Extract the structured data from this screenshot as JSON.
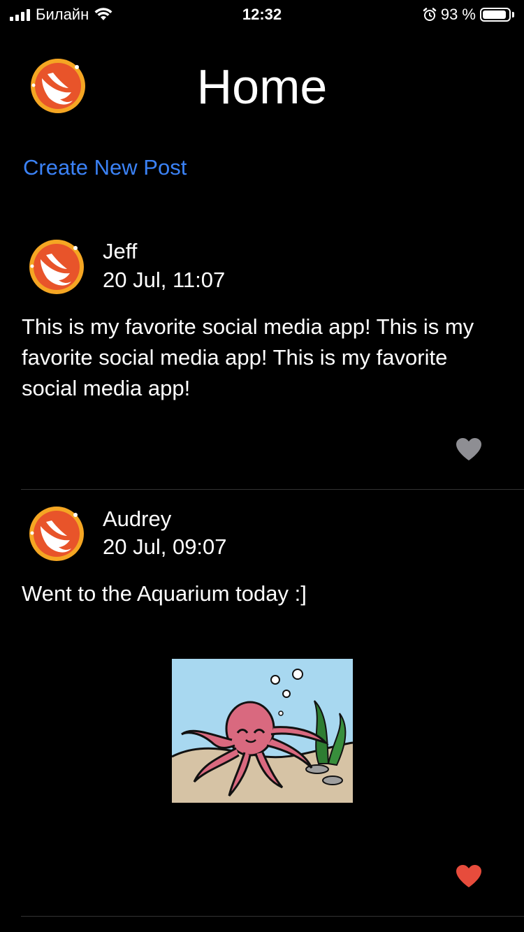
{
  "status_bar": {
    "carrier": "Билайн",
    "time": "12:32",
    "battery": "93 %",
    "battery_level": 0.93
  },
  "header": {
    "title": "Home",
    "create_post_label": "Create New Post"
  },
  "posts": [
    {
      "author": "Jeff",
      "date": "20 Jul, 11:07",
      "text": "This is my favorite social media app! This is my favorite social media app! This is my favorite social media app!",
      "liked": false,
      "like_color": "#8e8e93"
    },
    {
      "author": "Audrey",
      "date": "20 Jul, 09:07",
      "text": "Went to the Aquarium today :]",
      "liked": true,
      "like_color": "#e74c3c",
      "image": "octopus-aquarium-illustration"
    }
  ],
  "colors": {
    "background": "#000000",
    "link": "#3b82f6",
    "avatar_outer": "#f5a623",
    "avatar_inner": "#e8542a"
  }
}
